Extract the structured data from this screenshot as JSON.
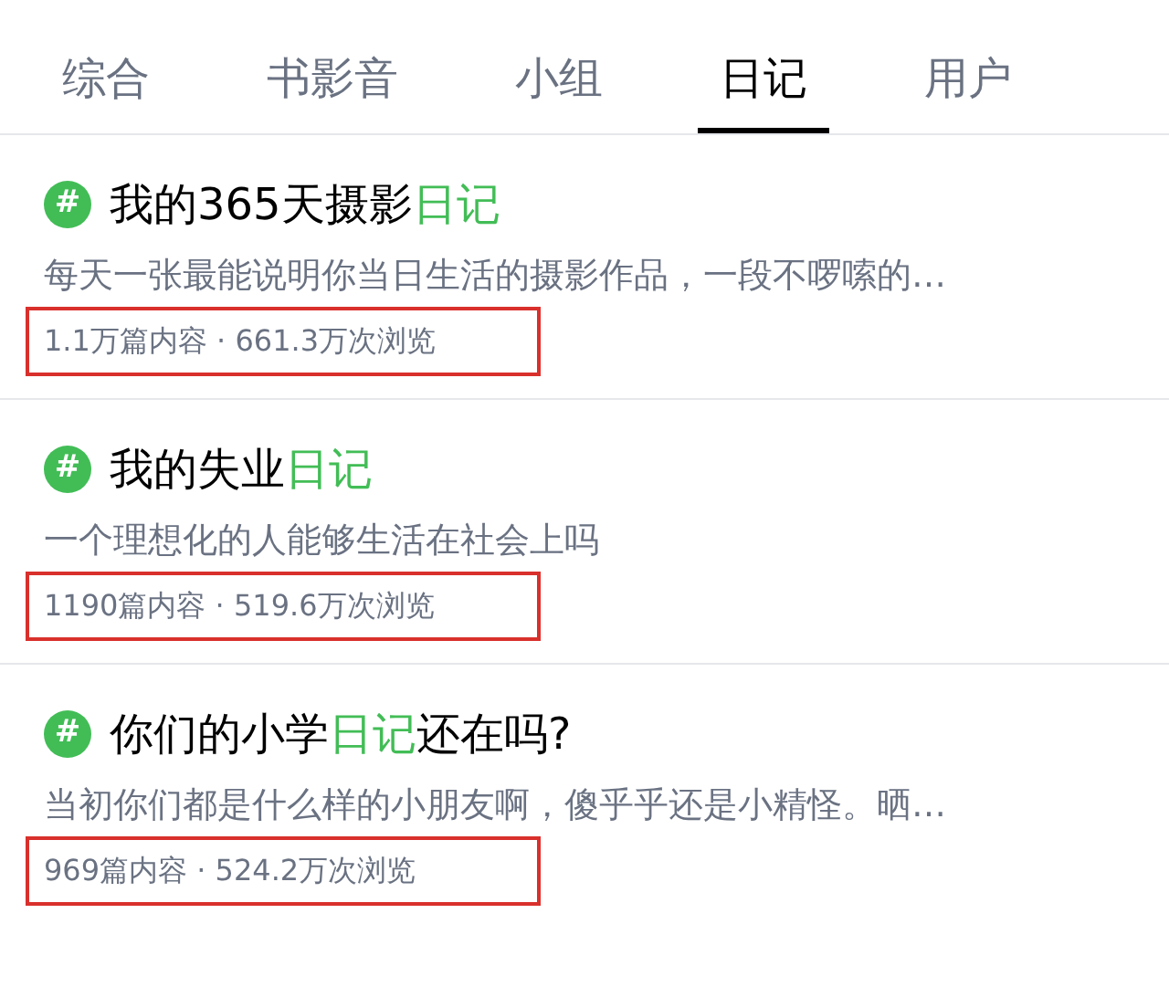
{
  "tabs": [
    {
      "label": "综合",
      "selected": false
    },
    {
      "label": "书影音",
      "selected": false
    },
    {
      "label": "小组",
      "selected": false
    },
    {
      "label": "日记",
      "selected": true
    },
    {
      "label": "用户",
      "selected": false
    }
  ],
  "results": [
    {
      "icon": "#",
      "title": [
        {
          "text": "我的365天摄影",
          "match": false
        },
        {
          "text": "日记",
          "match": true
        }
      ],
      "description": "每天一张最能说明你当日生活的摄影作品，一段不啰嗦的…",
      "stats": "1.1万篇内容 · 661.3万次浏览",
      "highlighted": true
    },
    {
      "icon": "#",
      "title": [
        {
          "text": "我的失业",
          "match": false
        },
        {
          "text": "日记",
          "match": true
        }
      ],
      "description": "一个理想化的人能够生活在社会上吗",
      "stats": "1190篇内容 · 519.6万次浏览",
      "highlighted": true
    },
    {
      "icon": "#",
      "title": [
        {
          "text": "你们的小学",
          "match": false
        },
        {
          "text": "日记",
          "match": true
        },
        {
          "text": "还在吗?",
          "match": false
        }
      ],
      "description": "当初你们都是什么样的小朋友啊，傻乎乎还是小精怪。晒…",
      "stats": "969篇内容 · 524.2万次浏览",
      "highlighted": true
    }
  ]
}
